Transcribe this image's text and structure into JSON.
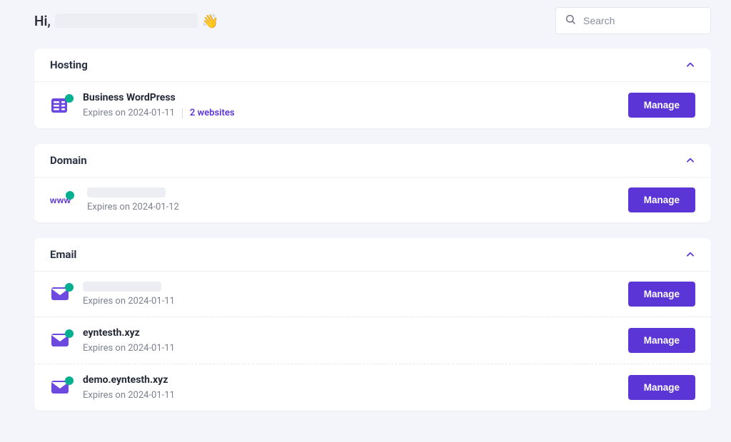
{
  "greeting": {
    "prefix": "Hi,"
  },
  "search": {
    "placeholder": "Search"
  },
  "sections": {
    "hosting": {
      "title": "Hosting",
      "items": [
        {
          "title": "Business WordPress",
          "expires": "Expires on 2024-01-11",
          "websites": "2 websites",
          "manage": "Manage"
        }
      ]
    },
    "domain": {
      "title": "Domain",
      "items": [
        {
          "title": "",
          "expires": "Expires on 2024-01-12",
          "manage": "Manage"
        }
      ]
    },
    "email": {
      "title": "Email",
      "items": [
        {
          "title": "",
          "expires": "Expires on 2024-01-11",
          "manage": "Manage"
        },
        {
          "title": "eyntesth.xyz",
          "expires": "Expires on 2024-01-11",
          "manage": "Manage"
        },
        {
          "title": "demo.eyntesth.xyz",
          "expires": "Expires on 2024-01-11",
          "manage": "Manage"
        }
      ]
    }
  }
}
